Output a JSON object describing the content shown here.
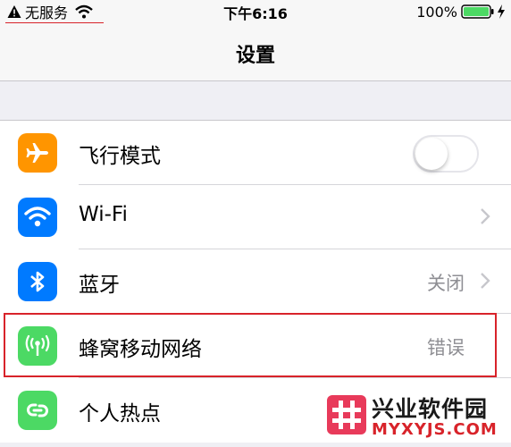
{
  "status_bar": {
    "carrier": "无服务",
    "time": "下午6:16",
    "battery": "100%",
    "battery_level": 1.0,
    "icons": [
      "warning-icon",
      "wifi-icon",
      "battery-icon",
      "charging-icon"
    ]
  },
  "nav": {
    "title": "设置"
  },
  "settings": {
    "items": [
      {
        "label": "飞行模式",
        "icon": "airplane-icon",
        "icon_color": "#ff9500",
        "toggle_on": false
      },
      {
        "label": "Wi-Fi",
        "icon": "wifi-icon",
        "icon_color": "#007aff"
      },
      {
        "label": "蓝牙",
        "icon": "bluetooth-icon",
        "icon_color": "#007aff",
        "value": "关闭"
      },
      {
        "label": "蜂窝移动网络",
        "icon": "cellular-icon",
        "icon_color": "#4cd964",
        "value": "错误"
      },
      {
        "label": "个人热点",
        "icon": "hotspot-icon",
        "icon_color": "#4cd964"
      }
    ]
  },
  "watermark": {
    "name": "兴业软件园",
    "site": "MYXYJS.COM",
    "logo_color": "#e83a5a"
  },
  "colors": {
    "highlight": "#d8232a",
    "background": "#efeff4",
    "separator": "#c8c7cc"
  }
}
